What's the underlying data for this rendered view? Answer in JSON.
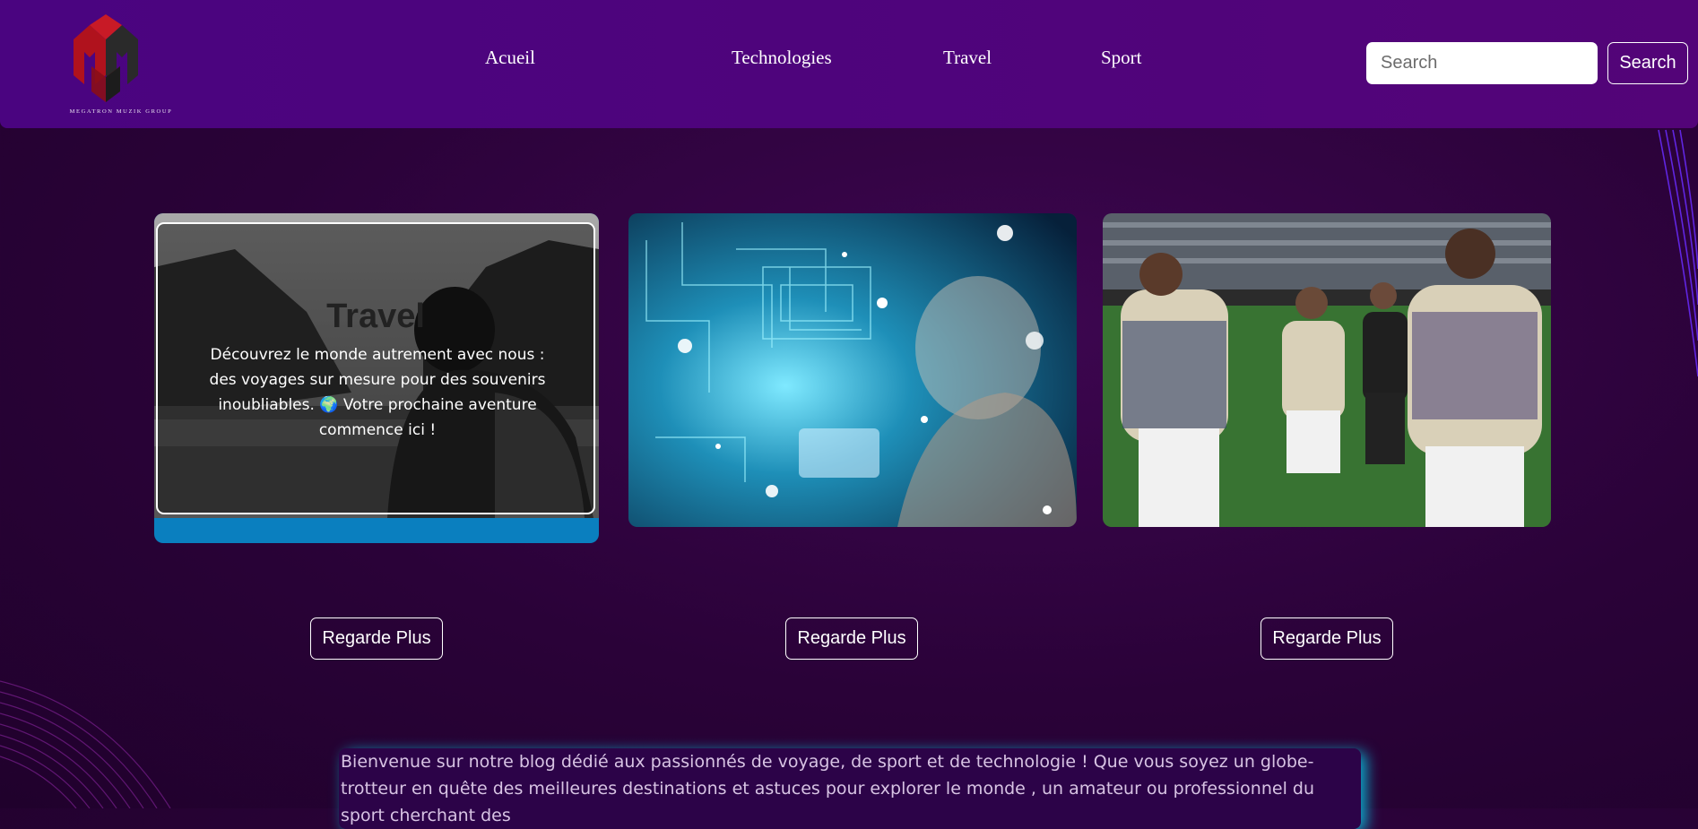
{
  "brand": {
    "caption": "MEGATRON MUZIK GROUP"
  },
  "nav": {
    "items": [
      {
        "label": "Acueil"
      },
      {
        "label": "Technologies"
      },
      {
        "label": "Travel"
      },
      {
        "label": "Sport"
      }
    ]
  },
  "search": {
    "placeholder": "Search",
    "button_label": "Search"
  },
  "cards": {
    "travel": {
      "title": "Travel",
      "text": "Découvrez le monde autrement avec nous : des voyages sur mesure pour des souvenirs inoubliables. 🌍 Votre prochaine aventure commence ici !"
    },
    "more_label": "Regarde Plus"
  },
  "intro": {
    "text": "Bienvenue sur notre blog dédié aux passionnés de voyage, de sport et de technologie ! Que vous soyez un globe-trotteur en quête des meilleures destinations et astuces pour explorer le monde , un amateur ou professionnel du sport cherchant des"
  },
  "colors": {
    "navbar": "#4a0480",
    "background": "#2a0238",
    "card_accent": "#0a7fbf",
    "glow": "#00e6ff"
  }
}
